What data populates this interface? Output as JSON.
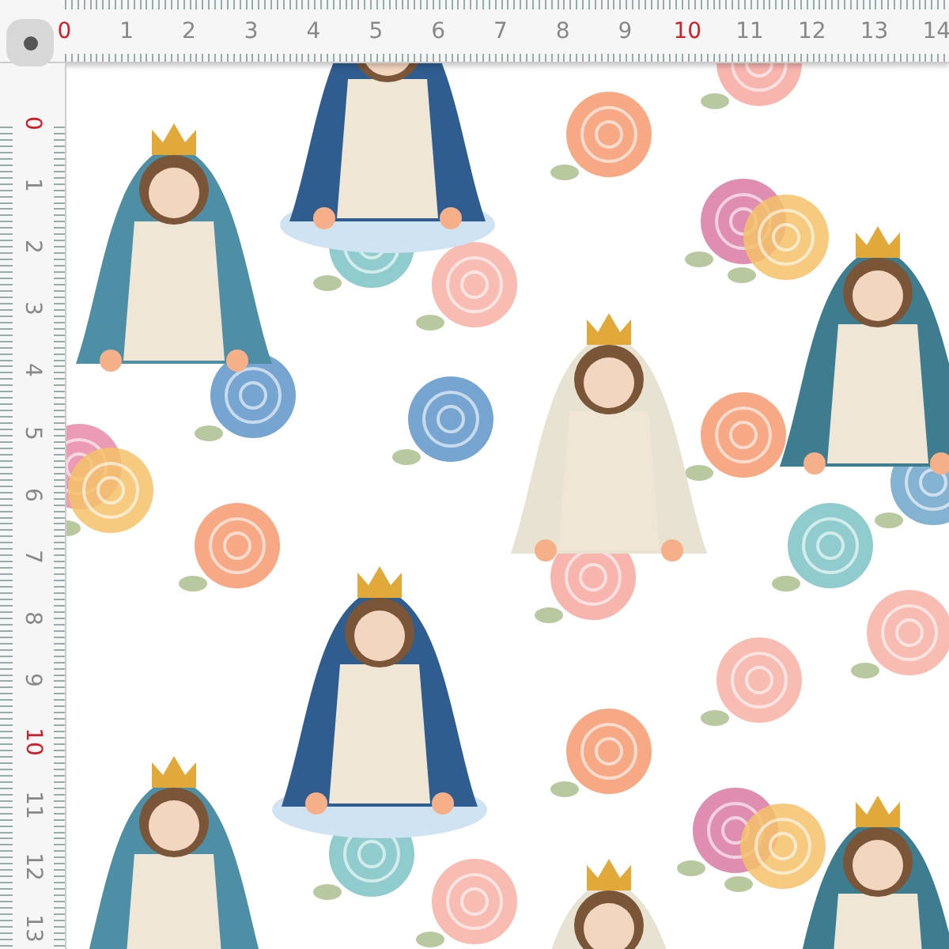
{
  "top_ruler": {
    "labels": [
      {
        "text": "0",
        "highlighted": true
      },
      {
        "text": "1",
        "highlighted": false
      },
      {
        "text": "2",
        "highlighted": false
      },
      {
        "text": "3",
        "highlighted": false
      },
      {
        "text": "4",
        "highlighted": false
      },
      {
        "text": "5",
        "highlighted": false
      },
      {
        "text": "6",
        "highlighted": false
      },
      {
        "text": "7",
        "highlighted": false
      },
      {
        "text": "8",
        "highlighted": false
      },
      {
        "text": "9",
        "highlighted": false
      },
      {
        "text": "10",
        "highlighted": true
      },
      {
        "text": "11",
        "highlighted": false
      },
      {
        "text": "12",
        "highlighted": false
      },
      {
        "text": "13",
        "highlighted": false
      },
      {
        "text": "14",
        "highlighted": false
      }
    ]
  },
  "side_ruler": {
    "labels": [
      {
        "text": "0",
        "highlighted": true
      },
      {
        "text": "1",
        "highlighted": false
      },
      {
        "text": "2",
        "highlighted": false
      },
      {
        "text": "3",
        "highlighted": false
      },
      {
        "text": "4",
        "highlighted": false
      },
      {
        "text": "5",
        "highlighted": false
      },
      {
        "text": "6",
        "highlighted": false
      },
      {
        "text": "7",
        "highlighted": false
      },
      {
        "text": "8",
        "highlighted": false
      },
      {
        "text": "9",
        "highlighted": false
      },
      {
        "text": "10",
        "highlighted": true
      },
      {
        "text": "11",
        "highlighted": false
      },
      {
        "text": "12",
        "highlighted": false
      },
      {
        "text": "13",
        "highlighted": false
      }
    ]
  }
}
